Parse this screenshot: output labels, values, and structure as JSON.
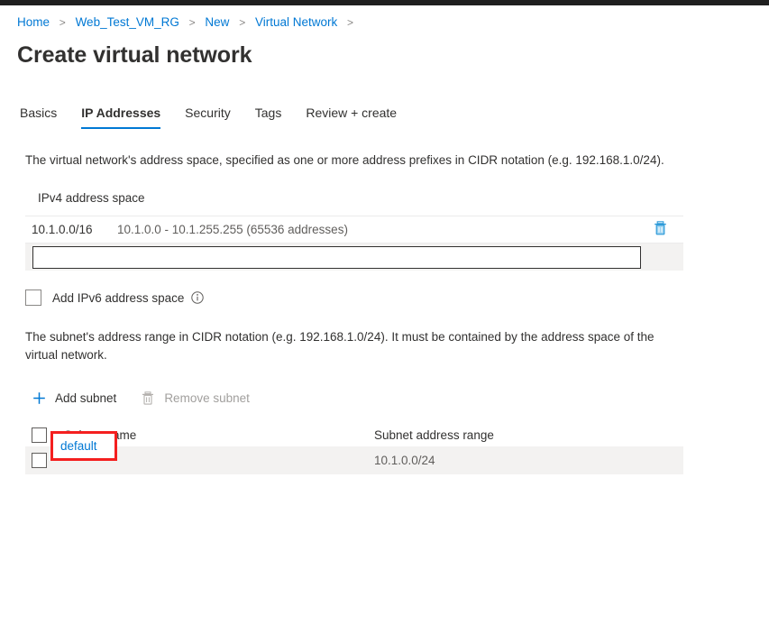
{
  "breadcrumb": {
    "separator": ">",
    "items": [
      {
        "label": "Home"
      },
      {
        "label": "Web_Test_VM_RG"
      },
      {
        "label": "New"
      },
      {
        "label": "Virtual Network"
      }
    ]
  },
  "page": {
    "title": "Create virtual network"
  },
  "tabs": [
    {
      "label": "Basics",
      "active": false
    },
    {
      "label": "IP Addresses",
      "active": true
    },
    {
      "label": "Security",
      "active": false
    },
    {
      "label": "Tags",
      "active": false
    },
    {
      "label": "Review + create",
      "active": false
    }
  ],
  "ipv4": {
    "description": "The virtual network's address space, specified as one or more address prefixes in CIDR notation (e.g. 192.168.1.0/24).",
    "section_label": "IPv4 address space",
    "rows": [
      {
        "cidr": "10.1.0.0/16",
        "range": "10.1.0.0 - 10.1.255.255 (65536 addresses)",
        "delete_icon": "trash-icon"
      }
    ],
    "new_address_input": {
      "value": "",
      "placeholder": ""
    }
  },
  "ipv6": {
    "checkbox_label": "Add IPv6 address space",
    "checked": false,
    "info_icon": "info-icon"
  },
  "subnets": {
    "description": "The subnet's address range in CIDR notation (e.g. 192.168.1.0/24). It must be contained by the address space of the virtual network.",
    "toolbar": {
      "add_label": "Add subnet",
      "add_icon": "plus-icon",
      "remove_label": "Remove subnet",
      "remove_icon": "trash-icon",
      "remove_disabled": true
    },
    "columns": [
      "Subnet name",
      "Subnet address range"
    ],
    "header_select_all_checked": false,
    "rows": [
      {
        "selected": false,
        "name": "default",
        "address_range": "10.1.0.0/24",
        "highlighted": true
      }
    ]
  },
  "colors": {
    "accent": "#0078d4",
    "text": "#323130",
    "muted": "#605e5c",
    "annotation": "#f41f1f",
    "row_bg": "#f3f2f1",
    "topbar": "#1f1f1f"
  }
}
